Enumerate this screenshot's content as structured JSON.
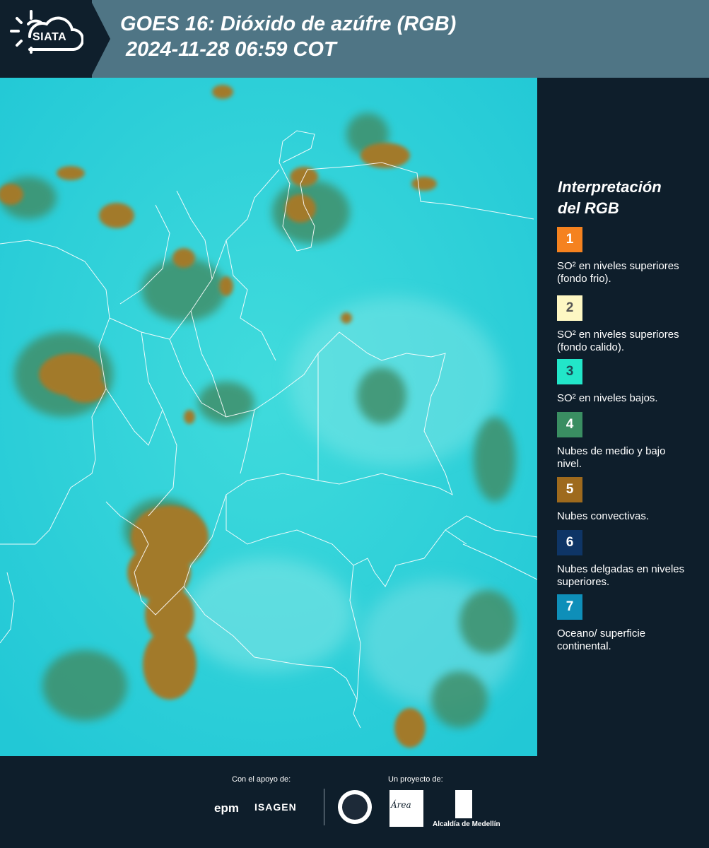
{
  "header": {
    "logo_text": "SIATA",
    "title_line1": "GOES 16: Dióxido de azúfre (RGB)",
    "title_line2": "2024-11-28 06:59 COT"
  },
  "legend": {
    "title_line1": "Interpretación",
    "title_line2": "del RGB",
    "items": [
      {
        "num": "1",
        "color": "#f5821f",
        "num_color": "#ffffff",
        "text": "SO² en niveles superiores (fondo frio)."
      },
      {
        "num": "2",
        "color": "#fdf7c3",
        "num_color": "#555555",
        "text": "SO² en niveles superiores (fondo calido)."
      },
      {
        "num": "3",
        "color": "#22e6c9",
        "num_color": "#1b4a55",
        "text": "SO² en niveles bajos."
      },
      {
        "num": "4",
        "color": "#3a8e62",
        "num_color": "#ffffff",
        "text": "Nubes de medio y bajo nivel."
      },
      {
        "num": "5",
        "color": "#9e6a1d",
        "num_color": "#ffffff",
        "text": "Nubes convectivas."
      },
      {
        "num": "6",
        "color": "#0e3566",
        "num_color": "#ffffff",
        "text": "Nubes delgadas en niveles superiores."
      },
      {
        "num": "7",
        "color": "#0e8fb9",
        "num_color": "#ffffff",
        "text": "Oceano/ superficie continental."
      }
    ]
  },
  "footer": {
    "support_label": "Con el apoyo de:",
    "project_label": "Un proyecto de:",
    "epm": "epm",
    "isagen": "ISAGEN",
    "area_text": "Área",
    "alcaldia": "Alcaldía de Medellín"
  },
  "map_colors": {
    "background": "#2fd3d8",
    "convective": "#a27a2c",
    "mid_low": "#3f8f6b",
    "borders": "#ffffff"
  }
}
